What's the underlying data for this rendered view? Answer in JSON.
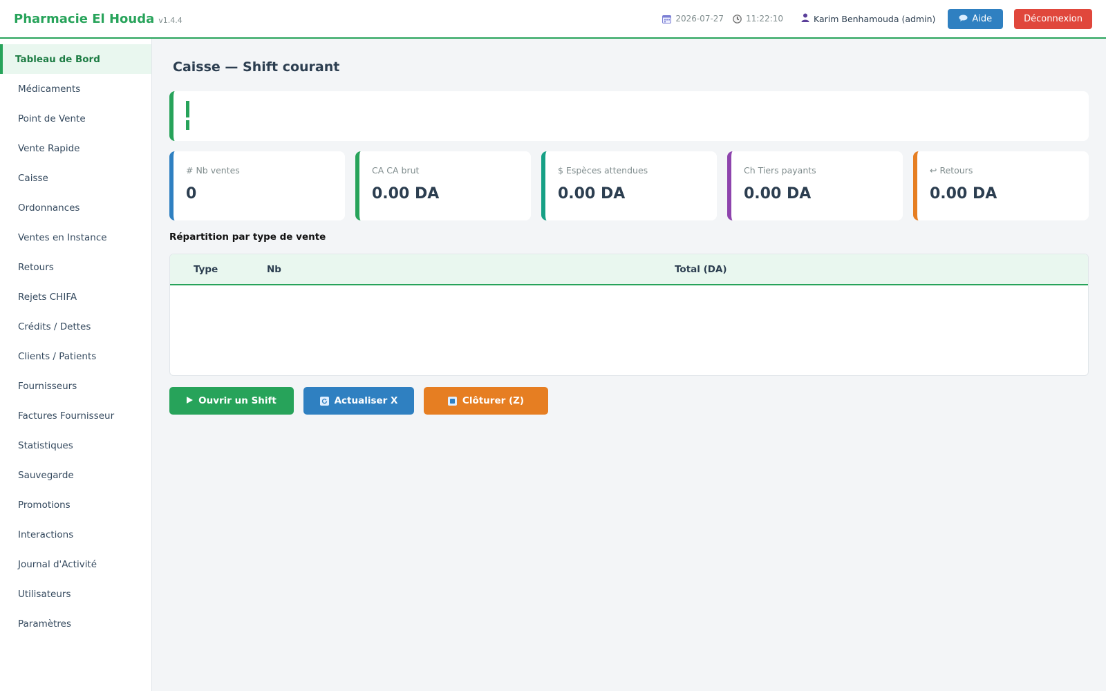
{
  "app": {
    "name": "Pharmacie El Houda",
    "version": "v1.4.4"
  },
  "header": {
    "date": "2026-07-27",
    "time": "11:22:10",
    "user": "Karim Benhamouda (admin)",
    "help_label": "Aide",
    "logout_label": "Déconnexion",
    "icons": {
      "date": "calendar-icon",
      "time": "clock-icon",
      "user": "user-icon",
      "help": "chat-bubble-icon"
    }
  },
  "sidebar": {
    "items": [
      {
        "label": "Tableau de Bord",
        "active": true
      },
      {
        "label": "Médicaments"
      },
      {
        "label": "Point de Vente"
      },
      {
        "label": "Vente Rapide"
      },
      {
        "label": "Caisse"
      },
      {
        "label": "Ordonnances"
      },
      {
        "label": "Ventes en Instance"
      },
      {
        "label": "Retours"
      },
      {
        "label": "Rejets CHIFA"
      },
      {
        "label": "Crédits / Dettes"
      },
      {
        "label": "Clients / Patients"
      },
      {
        "label": "Fournisseurs"
      },
      {
        "label": "Factures Fournisseur"
      },
      {
        "label": "Statistiques"
      },
      {
        "label": "Sauvegarde"
      },
      {
        "label": "Promotions"
      },
      {
        "label": "Interactions"
      },
      {
        "label": "Journal d'Activité"
      },
      {
        "label": "Utilisateurs"
      },
      {
        "label": "Paramètres"
      }
    ]
  },
  "main": {
    "title": "Caisse — Shift courant",
    "cards": [
      {
        "label": "# Nb ventes",
        "value": "0",
        "color": "#2f80c1"
      },
      {
        "label": "CA CA brut",
        "value": "0.00 DA",
        "color": "#27a35a"
      },
      {
        "label": "$ Espèces attendues",
        "value": "0.00 DA",
        "color": "#16a085"
      },
      {
        "label": "Ch Tiers payants",
        "value": "0.00 DA",
        "color": "#8e44ad"
      },
      {
        "label": "↩ Retours",
        "value": "0.00 DA",
        "color": "#e67e22"
      }
    ],
    "section_title": "Répartition par type de vente",
    "table": {
      "columns": [
        "Type",
        "Nb",
        "Total (DA)"
      ],
      "rows": []
    },
    "actions": {
      "open_label": "Ouvrir un Shift",
      "refresh_label": "Actualiser X",
      "close_label": "Clôturer (Z)"
    }
  },
  "colors": {
    "accent": "#27a35a",
    "blue": "#2f80c1",
    "red": "#e0473c",
    "orange": "#e67e22"
  }
}
